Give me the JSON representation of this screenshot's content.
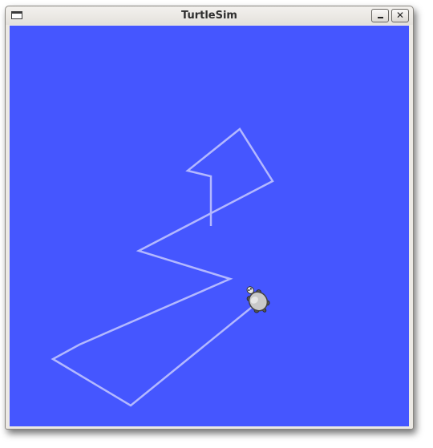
{
  "window": {
    "title": "TurtleSim",
    "menu_icon": "window-menu-icon",
    "minimize_icon": "minimize-icon",
    "close_glyph": "✕",
    "close_icon": "close-icon"
  },
  "canvas": {
    "background_color": "#4556ff",
    "pen_color": "#b3b8ff"
  },
  "turtle": {
    "icon": "turtle-icon",
    "heading": "up-right",
    "shell_color": "#c9c9c9"
  }
}
